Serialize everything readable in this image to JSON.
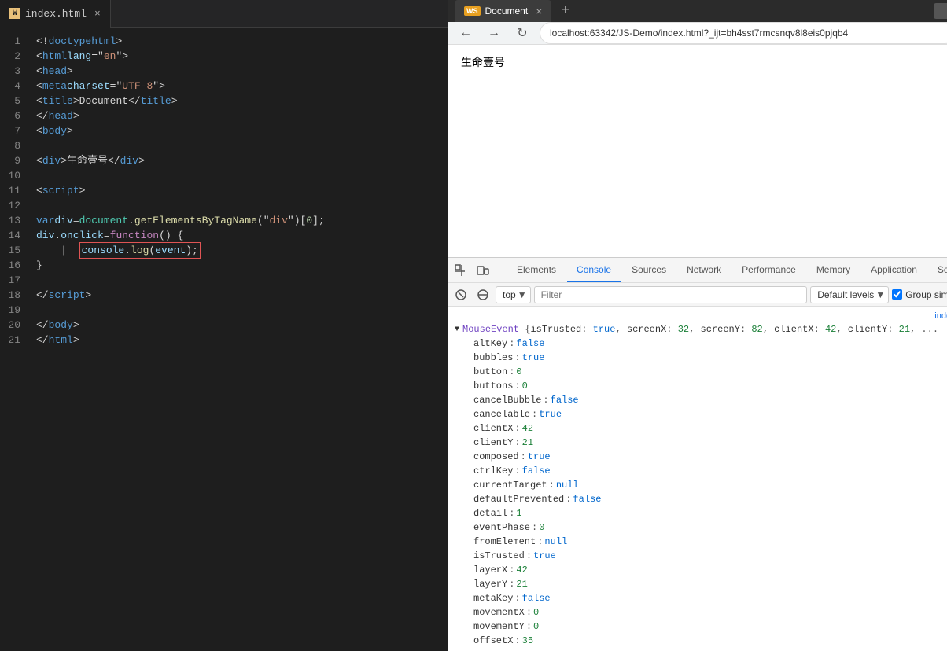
{
  "editor": {
    "tab_name": "index.html",
    "lines": [
      {
        "num": 1,
        "html": "<span class='punct'>&lt;!</span><span class='kw'>doctype</span> <span class='kw'>html</span><span class='punct'>&gt;</span>"
      },
      {
        "num": 2,
        "html": "<span class='punct'>&lt;</span><span class='tag'>html</span> <span class='attr'>lang</span><span class='punct'>=\"</span><span class='str'>en</span><span class='punct'>\"&gt;</span>"
      },
      {
        "num": 3,
        "html": "<span class='punct'>&lt;</span><span class='tag'>head</span><span class='punct'>&gt;</span>"
      },
      {
        "num": 4,
        "html": "    <span class='punct'>&lt;</span><span class='tag'>meta</span> <span class='attr'>charset</span><span class='punct'>=\"</span><span class='str'>UTF-8</span><span class='punct'>\"&gt;</span>"
      },
      {
        "num": 5,
        "html": "    <span class='punct'>&lt;</span><span class='tag'>title</span><span class='punct'>&gt;</span><span class='title-val'>Document</span><span class='punct'>&lt;/</span><span class='tag'>title</span><span class='punct'>&gt;</span>"
      },
      {
        "num": 6,
        "html": "<span class='punct'>&lt;/</span><span class='tag'>head</span><span class='punct'>&gt;</span>"
      },
      {
        "num": 7,
        "html": "<span class='punct'>&lt;</span><span class='tag'>body</span><span class='punct'>&gt;</span>"
      },
      {
        "num": 8,
        "html": ""
      },
      {
        "num": 9,
        "html": "<span class='punct'>&lt;</span><span class='tag'>div</span><span class='punct'>&gt;</span><span class='cn'>生命壹号</span><span class='punct'>&lt;/</span><span class='tag'>div</span><span class='punct'>&gt;</span>"
      },
      {
        "num": 10,
        "html": ""
      },
      {
        "num": 11,
        "html": "<span class='punct'>&lt;</span><span class='tag'>script</span><span class='punct'>&gt;</span>"
      },
      {
        "num": 12,
        "html": ""
      },
      {
        "num": 13,
        "html": "    <span class='kw'>var</span> <span class='var-name'>div</span> = <span class='obj'>document</span>.<span class='method'>getElementsByTagName</span>(<span class='str'>\"div\"</span>)[<span class='num'>0</span>];"
      },
      {
        "num": 14,
        "html": "    <span class='var-name'>div</span>.<span class='cn'>onclick</span> = <span class='kw2'>function</span> () {"
      },
      {
        "num": 15,
        "html": "    |  <span class='console-log-hl'><span class='console-c'>console</span>.<span class='log-c'>log</span>(<span class='event-c'>event</span>);</span>"
      },
      {
        "num": 16,
        "html": "    }"
      },
      {
        "num": 17,
        "html": ""
      },
      {
        "num": 18,
        "html": "<span class='punct'>&lt;/</span><span class='tag'>script</span><span class='punct'>&gt;</span>"
      },
      {
        "num": 19,
        "html": ""
      },
      {
        "num": 20,
        "html": "<span class='punct'>&lt;/</span><span class='tag'>body</span><span class='punct'>&gt;</span>"
      },
      {
        "num": 21,
        "html": "<span class='punct'>&lt;/</span><span class='tag'>html</span><span class='punct'>&gt;</span>"
      }
    ]
  },
  "browser": {
    "tab_title": "Document",
    "url": "localhost:63342/JS-Demo/index.html?_ijt=bh4sst7rmcsnqv8l8eis0pjqb4",
    "page_text": "生命壹号"
  },
  "devtools": {
    "tabs": [
      {
        "label": "Elements",
        "active": false
      },
      {
        "label": "Console",
        "active": true
      },
      {
        "label": "Sources",
        "active": false
      },
      {
        "label": "Network",
        "active": false
      },
      {
        "label": "Performance",
        "active": false
      },
      {
        "label": "Memory",
        "active": false
      },
      {
        "label": "Application",
        "active": false
      },
      {
        "label": "Se",
        "active": false
      }
    ],
    "console": {
      "top_select": "top",
      "filter_placeholder": "Filter",
      "levels_label": "Default levels",
      "group_similar_label": "Group simila",
      "source_ref": "index",
      "event_header": "▼ MouseEvent {isTrusted: true, screenX: 32, screenY: 82, clientX: 42, clientY: 21, ...",
      "properties": [
        {
          "key": "altKey",
          "sep": ":",
          "val": "false",
          "type": "bool-false"
        },
        {
          "key": "bubbles",
          "sep": ":",
          "val": "true",
          "type": "bool-true"
        },
        {
          "key": "button",
          "sep": ":",
          "val": "0",
          "type": "num"
        },
        {
          "key": "buttons",
          "sep": ":",
          "val": "0",
          "type": "num"
        },
        {
          "key": "cancelBubble",
          "sep": ":",
          "val": "false",
          "type": "bool-false"
        },
        {
          "key": "cancelable",
          "sep": ":",
          "val": "true",
          "type": "bool-true"
        },
        {
          "key": "clientX",
          "sep": ":",
          "val": "42",
          "type": "num"
        },
        {
          "key": "clientY",
          "sep": ":",
          "val": "21",
          "type": "num"
        },
        {
          "key": "composed",
          "sep": ":",
          "val": "true",
          "type": "bool-true"
        },
        {
          "key": "ctrlKey",
          "sep": ":",
          "val": "false",
          "type": "bool-false"
        },
        {
          "key": "currentTarget",
          "sep": ":",
          "val": "null",
          "type": "null"
        },
        {
          "key": "defaultPrevented",
          "sep": ":",
          "val": "false",
          "type": "bool-false"
        },
        {
          "key": "detail",
          "sep": ":",
          "val": "1",
          "type": "num"
        },
        {
          "key": "eventPhase",
          "sep": ":",
          "val": "0",
          "type": "num"
        },
        {
          "key": "fromElement",
          "sep": ":",
          "val": "null",
          "type": "null"
        },
        {
          "key": "isTrusted",
          "sep": ":",
          "val": "true",
          "type": "bool-true"
        },
        {
          "key": "layerX",
          "sep": ":",
          "val": "42",
          "type": "num"
        },
        {
          "key": "layerY",
          "sep": ":",
          "val": "21",
          "type": "num"
        },
        {
          "key": "metaKey",
          "sep": ":",
          "val": "false",
          "type": "bool-false"
        },
        {
          "key": "movementX",
          "sep": ":",
          "val": "0",
          "type": "num"
        },
        {
          "key": "movementY",
          "sep": ":",
          "val": "0",
          "type": "num"
        },
        {
          "key": "offsetX",
          "sep": ":",
          "val": "35",
          "type": "num"
        }
      ]
    }
  }
}
